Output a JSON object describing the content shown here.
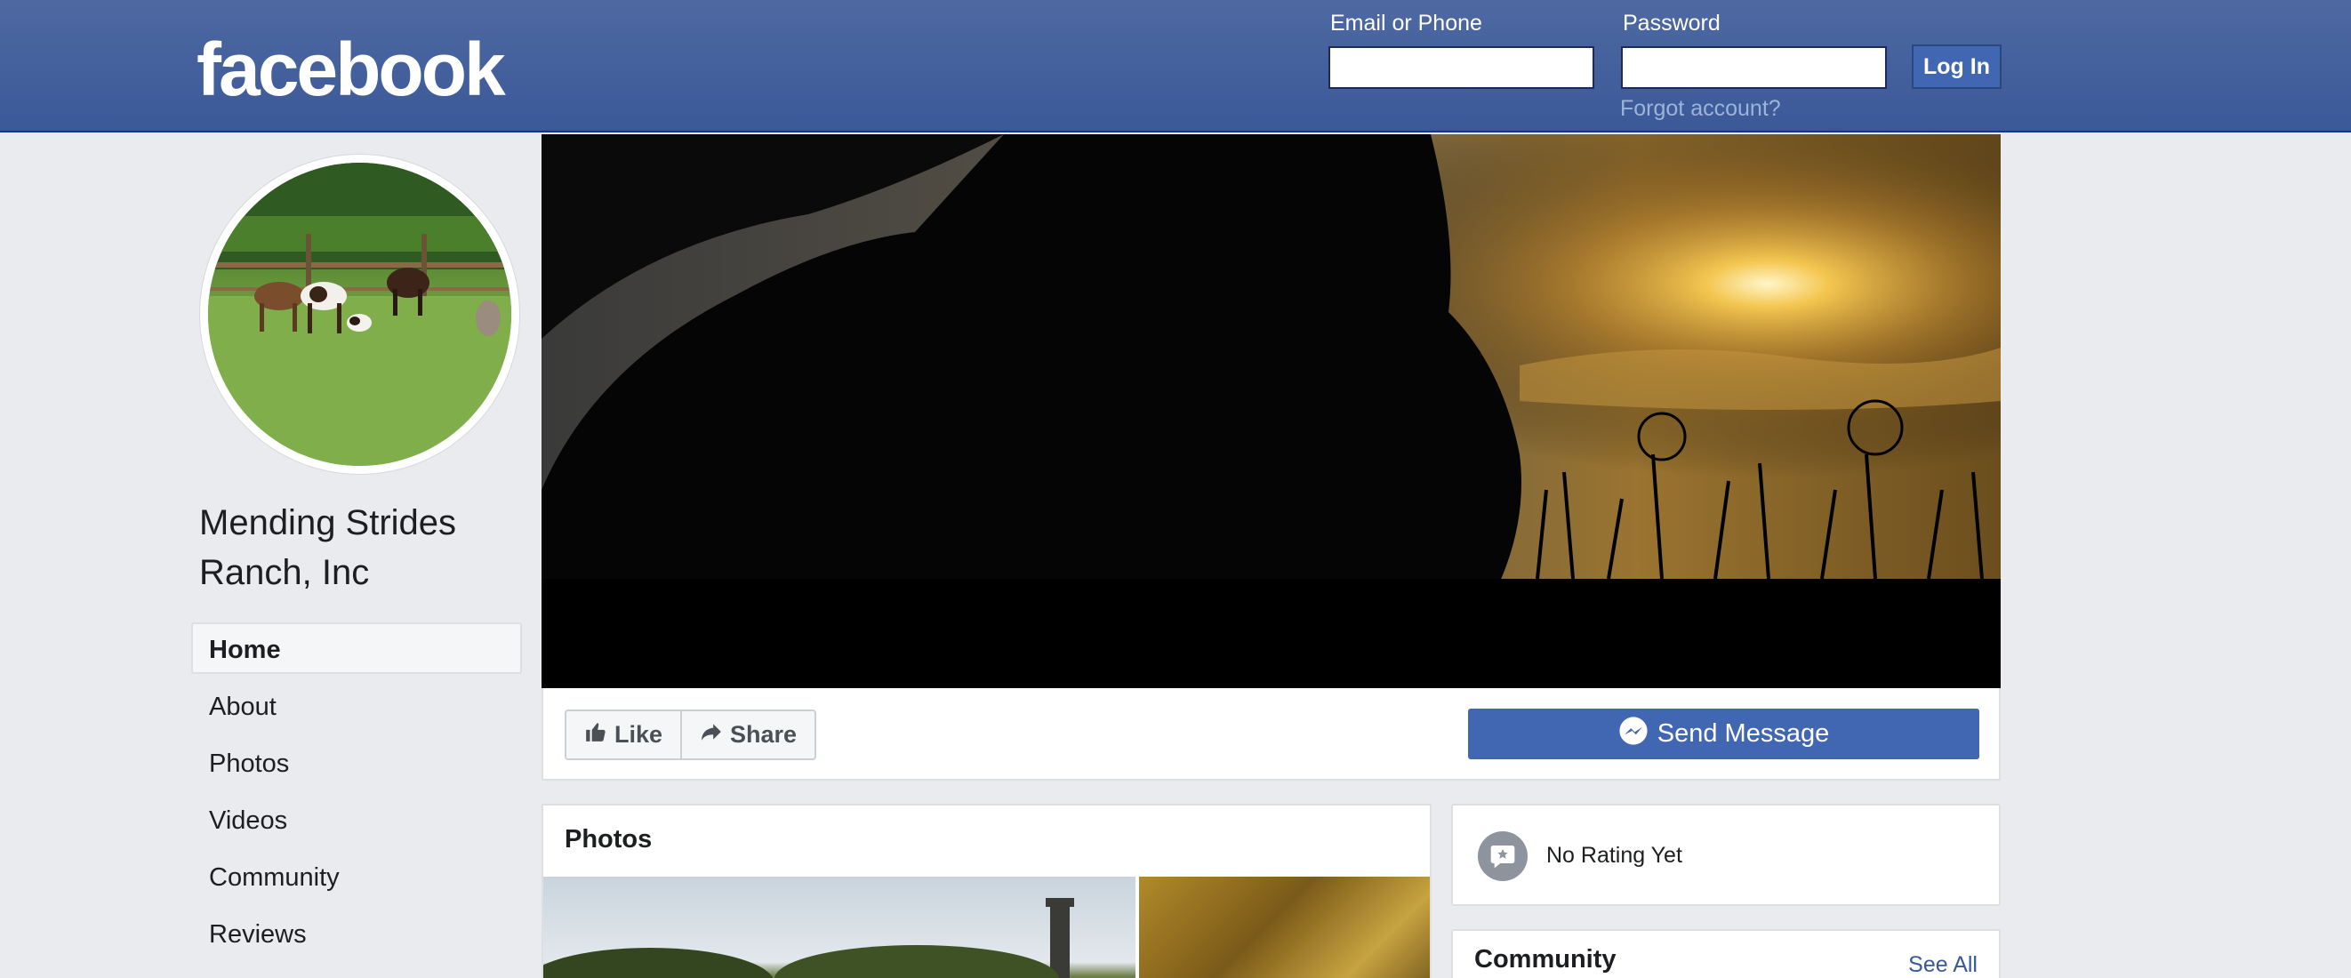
{
  "header": {
    "logo_text": "facebook",
    "email_label": "Email or Phone",
    "password_label": "Password",
    "login_button": "Log In",
    "forgot_link": "Forgot account?"
  },
  "page": {
    "name": "Mending Strides Ranch, Inc"
  },
  "sidebar": {
    "items": [
      {
        "label": "Home",
        "active": true
      },
      {
        "label": "About"
      },
      {
        "label": "Photos"
      },
      {
        "label": "Videos"
      },
      {
        "label": "Community"
      },
      {
        "label": "Reviews"
      }
    ]
  },
  "actions": {
    "like": "Like",
    "share": "Share",
    "send_message": "Send Message"
  },
  "photos": {
    "title": "Photos"
  },
  "rating": {
    "text": "No Rating Yet"
  },
  "community": {
    "title": "Community",
    "see_all": "See All"
  },
  "colors": {
    "brand_blue": "#3b5998",
    "button_blue": "#4267b2",
    "background": "#e9ebee"
  },
  "icons": [
    "like-icon",
    "share-icon",
    "messenger-icon",
    "rating-icon"
  ]
}
